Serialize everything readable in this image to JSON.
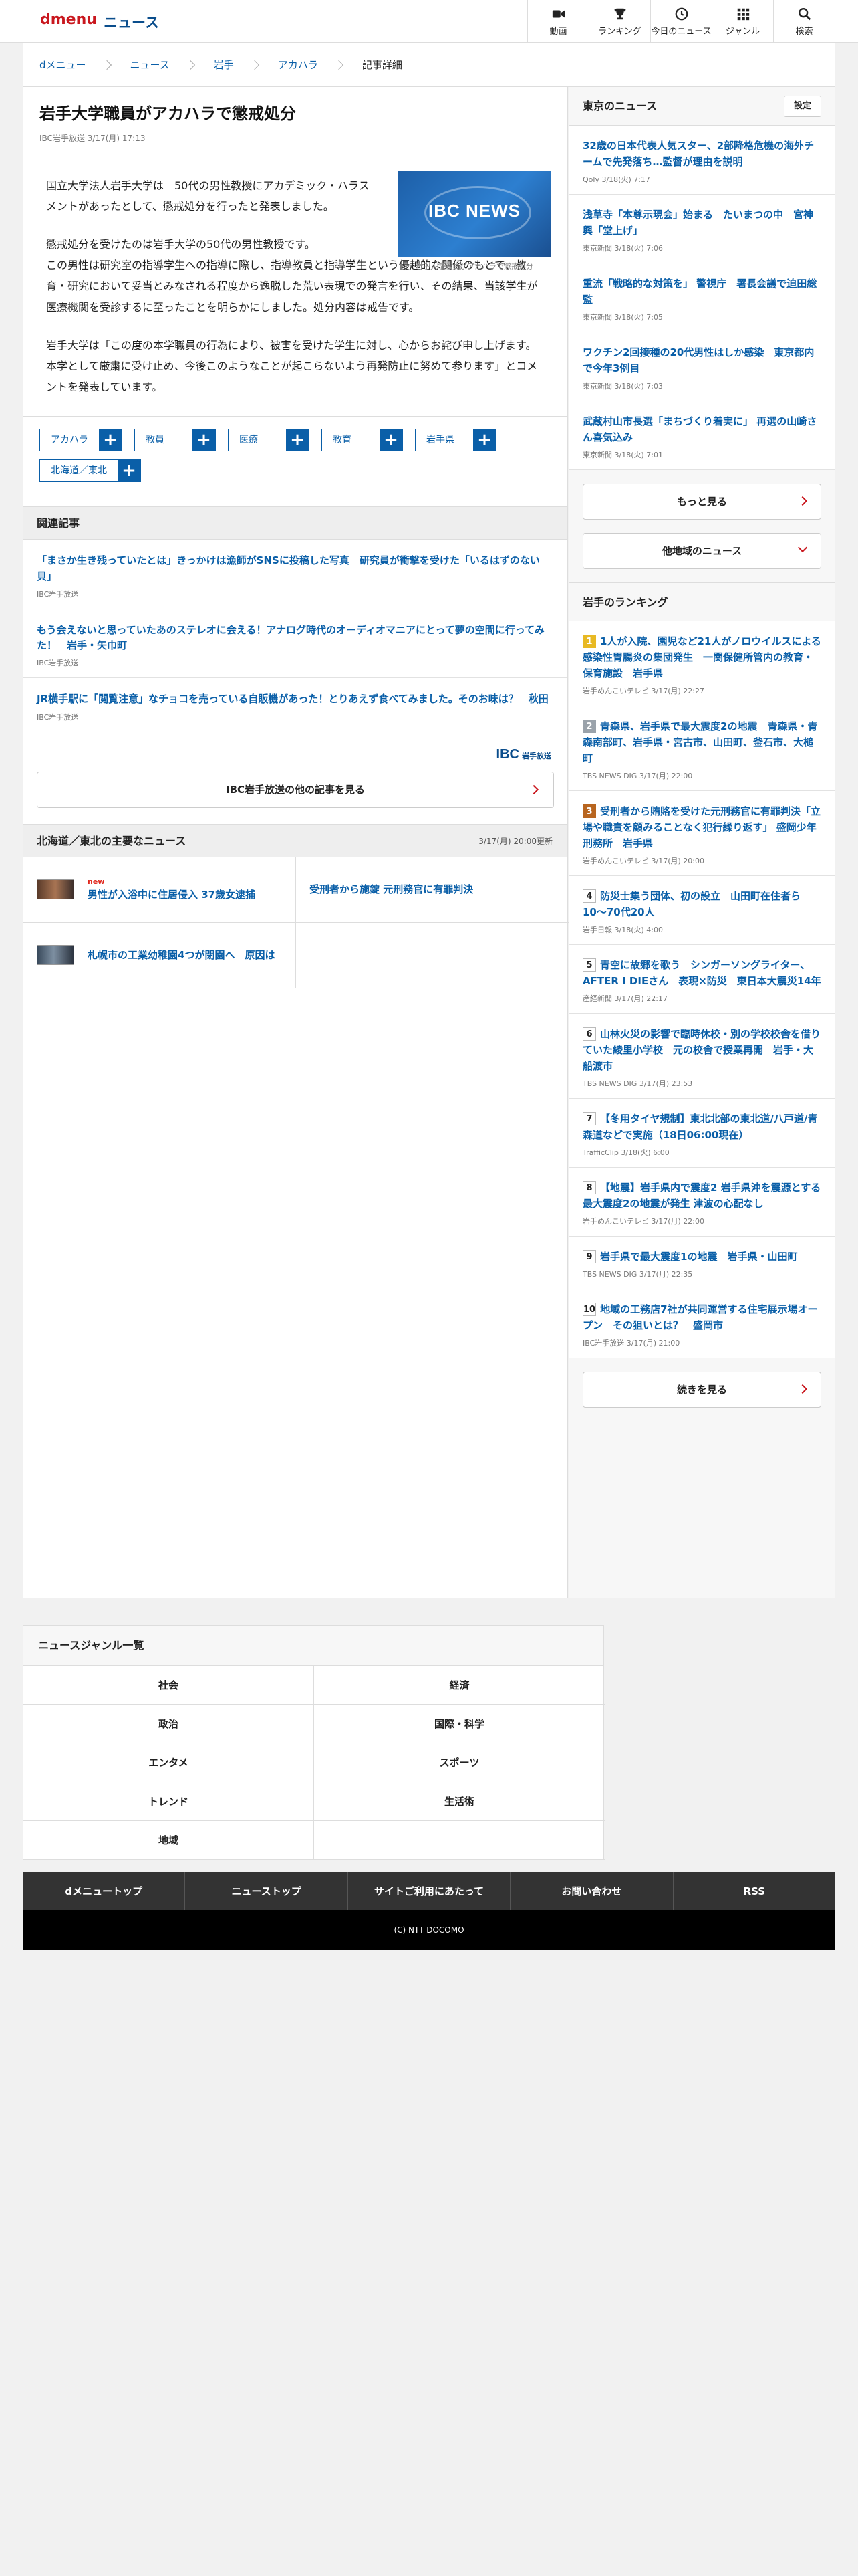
{
  "header": {
    "logo": "dmenu",
    "section": "ニュース",
    "nav": [
      {
        "label": "動画",
        "icon": "video-icon"
      },
      {
        "label": "ランキング",
        "icon": "trophy-icon"
      },
      {
        "label": "今日のニュース",
        "icon": "clock-icon"
      },
      {
        "label": "ジャンル",
        "icon": "grid-icon"
      },
      {
        "label": "検索",
        "icon": "search-icon"
      }
    ]
  },
  "breadcrumb": [
    "dメニュー",
    "ニュース",
    "岩手",
    "アカハラ",
    "記事詳細"
  ],
  "article": {
    "title": "岩手大学職員がアカハラで懲戒処分",
    "meta": "IBC岩手放送 3/17(月) 17:13",
    "photo_caption": "岩手大学職員がアカハラで懲戒処分",
    "photo_logo": "IBC NEWS",
    "paragraphs": [
      "国立大学法人岩手大学は　50代の男性教授にアカデミック・ハラスメントがあったとして、懲戒処分を行ったと発表しました。",
      "懲戒処分を受けたのは岩手大学の50代の男性教授です。\nこの男性は研究室の指導学生への指導に際し、指導教員と指導学生という優越的な関係のもとで、教育・研究において妥当とみなされる程度から逸脱した荒い表現での発言を行い、その結果、当該学生が医療機関を受診するに至ったことを明らかにしました。処分内容は戒告です。",
      "岩手大学は「この度の本学職員の行為により、被害を受けた学生に対し、心からお詫び申し上げます。本学として厳粛に受け止め、今後このようなことが起こらないよう再発防止に努めて参ります」とコメントを発表しています。"
    ],
    "tags": [
      "アカハラ",
      "教員",
      "医療",
      "教育",
      "岩手県",
      "北海道／東北"
    ]
  },
  "related": {
    "heading": "関連記事",
    "items": [
      {
        "title": "「まさか生き残っていたとは」きっかけは漁師がSNSに投稿した写真　研究員が衝撃を受けた「いるはずのない貝」",
        "source": "IBC岩手放送"
      },
      {
        "title": "もう会えないと思っていたあのステレオに会える！アナログ時代のオーディオマニアにとって夢の空間に行ってみた！　岩手・矢巾町",
        "source": "IBC岩手放送"
      },
      {
        "title": "JR横手駅に「閲覧注意」なチョコを売っている自販機があった！とりあえず食べてみました。そのお味は？　秋田",
        "source": "IBC岩手放送"
      }
    ],
    "provider_logo": "IBC",
    "provider_logo_sub": "岩手放送",
    "more_label": "IBC岩手放送の他の記事を見る"
  },
  "regional": {
    "heading": "北海道／東北の主要なニュース",
    "updated": "3/17(月) 20:00更新",
    "new_label": "new",
    "items": [
      {
        "title": "男性が入浴中に住居侵入 37歳女逮捕",
        "thumb": true,
        "is_new": true
      },
      {
        "title": "受刑者から施錠 元刑務官に有罪判決",
        "thumb": false,
        "is_new": false
      },
      {
        "title": "札幌市の工業幼稚園4つが閉園へ　原因は",
        "thumb": true,
        "is_new": false
      },
      {
        "title": "",
        "thumb": false,
        "is_new": false
      }
    ]
  },
  "tokyo": {
    "heading": "東京のニュース",
    "settings_label": "設定",
    "items": [
      {
        "title": "32歳の日本代表人気スター、2部降格危機の海外チームで先発落ち…監督が理由を説明",
        "source": "Qoly 3/18(火) 7:17"
      },
      {
        "title": "浅草寺「本尊示現会」始まる　たいまつの中　宮神興「堂上げ」",
        "source": "東京新聞 3/18(火) 7:06"
      },
      {
        "title": "重流「戦略的な対策を」 警視庁　署長会議で迫田総監",
        "source": "東京新聞 3/18(火) 7:05"
      },
      {
        "title": "ワクチン2回接種の20代男性はしか感染　東京都内で今年3例目",
        "source": "東京新聞 3/18(火) 7:03"
      },
      {
        "title": "武蔵村山市長選「まちづくり着実に」 再選の山崎さん喜気込み",
        "source": "東京新聞 3/18(火) 7:01"
      }
    ],
    "more_label": "もっと見る",
    "other_label": "他地域のニュース"
  },
  "ranking": {
    "heading": "岩手のランキング",
    "items": [
      {
        "rank": "1",
        "title": "1人が入院、園児など21人がノロウイルスによる感染性胃腸炎の集団発生　一関保健所管内の教育・保育施設　岩手県",
        "source": "岩手めんこいテレビ 3/17(月) 22:27"
      },
      {
        "rank": "2",
        "title": "青森県、岩手県で最大震度2の地震　青森県・青森南部町、岩手県・宮古市、山田町、釜石市、大槌町",
        "source": "TBS NEWS DIG 3/17(月) 22:00"
      },
      {
        "rank": "3",
        "title": "受刑者から賄賂を受けた元刑務官に有罪判決「立場や職責を顧みることなく犯行繰り返す」 盛岡少年刑務所　岩手県",
        "source": "岩手めんこいテレビ 3/17(月) 20:00"
      },
      {
        "rank": "4",
        "title": "防災士集う団体、初の設立　山田町在住者ら10〜70代20人",
        "source": "岩手日報 3/18(火) 4:00"
      },
      {
        "rank": "5",
        "title": "青空に故郷を歌う　シンガーソングライター、AFTER I DIEさん　表現×防災　東日本大震災14年",
        "source": "産経新聞 3/17(月) 22:17"
      },
      {
        "rank": "6",
        "title": "山林火災の影響で臨時休校・別の学校校舎を借りていた綾里小学校　元の校舎で授業再開　岩手・大船渡市",
        "source": "TBS NEWS DIG 3/17(月) 23:53"
      },
      {
        "rank": "7",
        "title": "【冬用タイヤ規制】東北北部の東北道/八戸道/青森道などで実施（18日06:00現在）",
        "source": "TrafficClip 3/18(火) 6:00"
      },
      {
        "rank": "8",
        "title": "【地震】岩手県内で震度2 岩手県沖を震源とする最大震度2の地震が発生 津波の心配なし",
        "source": "岩手めんこいテレビ 3/17(月) 22:00"
      },
      {
        "rank": "9",
        "title": "岩手県で最大震度1の地震　岩手県・山田町",
        "source": "TBS NEWS DIG 3/17(月) 22:35"
      },
      {
        "rank": "10",
        "title": "地域の工務店7社が共同運営する住宅展示場オープン　その狙いとは？　盛岡市",
        "source": "IBC岩手放送 3/17(月) 21:00"
      }
    ],
    "more_label": "続きを見る"
  },
  "genres": {
    "heading": "ニュースジャンル一覧",
    "items": [
      "社会",
      "経済",
      "政治",
      "国際・科学",
      "エンタメ",
      "スポーツ",
      "トレンド",
      "生活術",
      "地域",
      ""
    ]
  },
  "footer": {
    "links": [
      "dメニュートップ",
      "ニューストップ",
      "サイトご利用にあたって",
      "お問い合わせ",
      "RSS"
    ],
    "copyright": "(C) NTT DOCOMO"
  },
  "colors": {
    "brand_red": "#c9171e",
    "link_blue": "#0a5fa8",
    "tag_blue": "#0a5fa8"
  }
}
